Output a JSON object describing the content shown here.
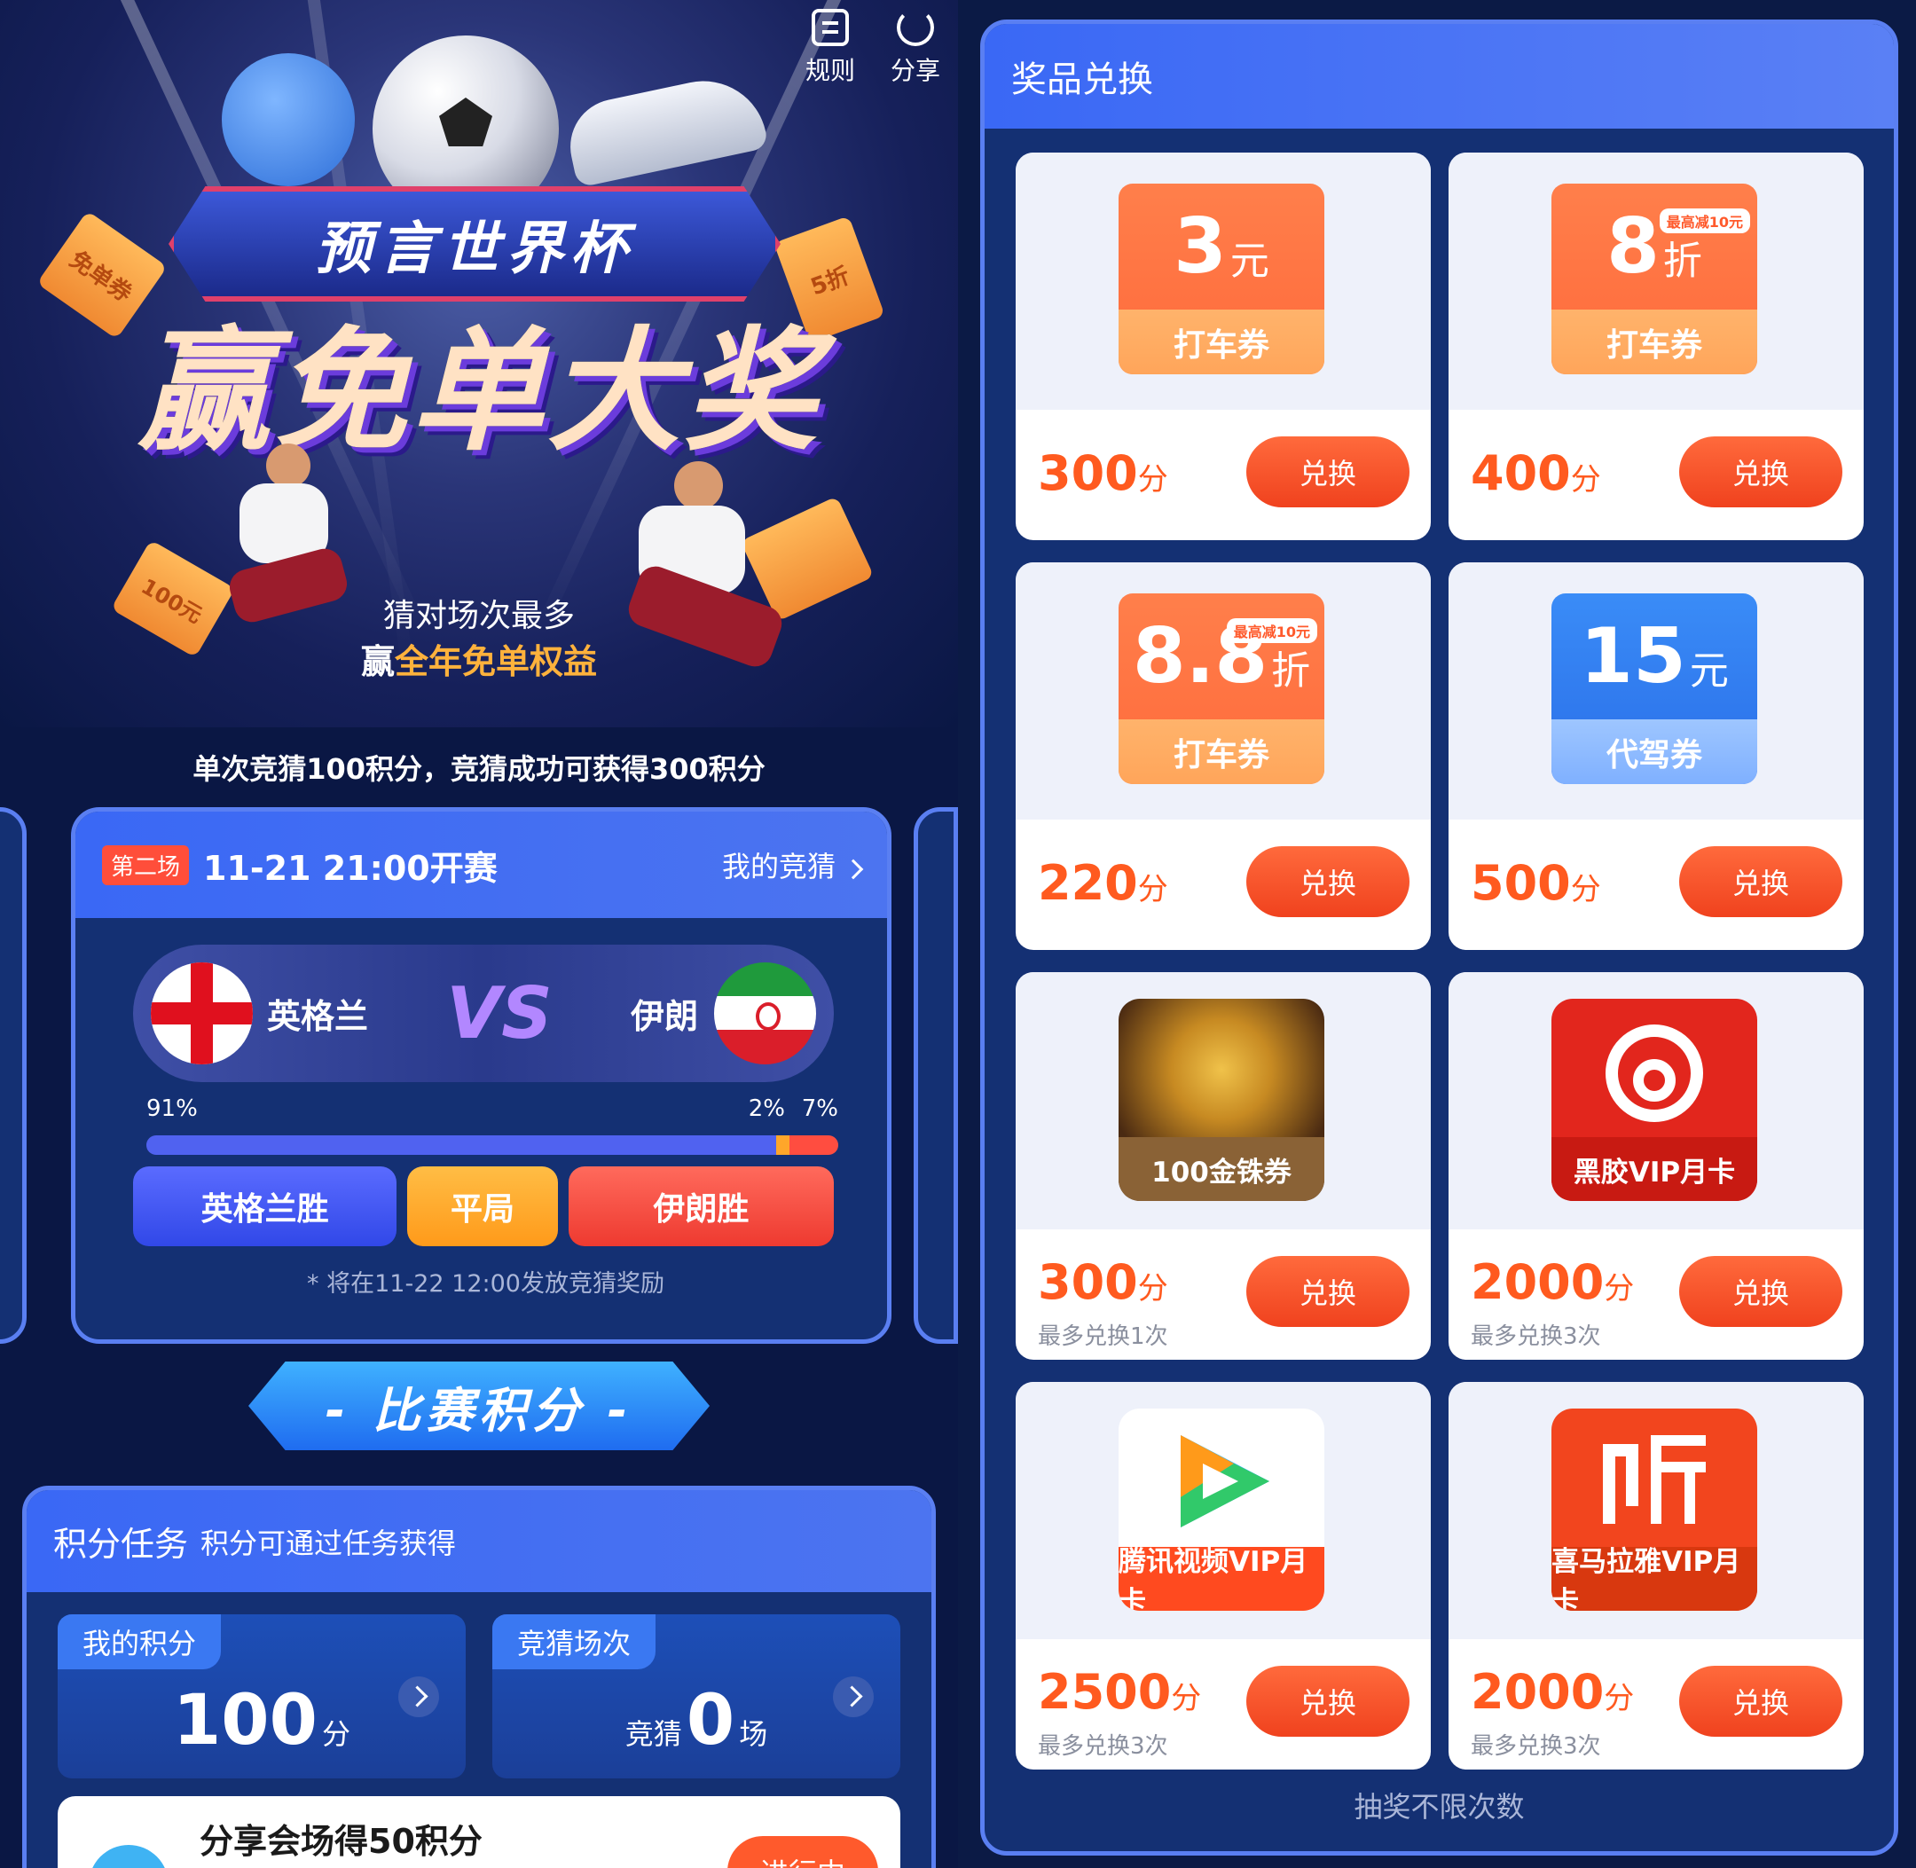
{
  "top_actions": {
    "rules": "规则",
    "share": "分享"
  },
  "hero": {
    "badge_title": "预言世界杯",
    "slogan": "赢免单大奖",
    "ticket_left": "免单券",
    "ticket_right": "5折",
    "ticket_bottom_left": "100元",
    "tagline": "猜对场次最多",
    "prize_prefix": "赢",
    "prize_highlight": "全年免单权益"
  },
  "rule_line": "单次竞猜100积分，竞猜成功可获得300积分",
  "match": {
    "round": "第二场",
    "kickoff": "11-21 21:00开赛",
    "my_guess": "我的竞猜",
    "team_a": "英格兰",
    "vs": "VS",
    "team_b": "伊朗",
    "pct_a": "91%",
    "pct_draw": "2%",
    "pct_b": "7%",
    "share_a": 91,
    "share_draw": 2,
    "share_b": 7,
    "vote_a": "英格兰胜",
    "vote_draw": "平局",
    "vote_b": "伊朗胜",
    "reward_note": "* 将在11-22 12:00发放竞猜奖励"
  },
  "score_banner": "- 比赛积分 -",
  "tasks": {
    "title": "积分任务",
    "subtitle": "积分可通过任务获得",
    "my_points_tab": "我的积分",
    "my_points_value": "100",
    "my_points_unit": "分",
    "guess_tab": "竞猜场次",
    "guess_prefix": "竞猜",
    "guess_value": "0",
    "guess_unit": "场",
    "share_task": "分享会场得50积分",
    "share_status": "进行中"
  },
  "prizes": {
    "title": "奖品兑换",
    "exchange_label": "兑换",
    "points_unit": "分",
    "items": [
      {
        "big": "3",
        "unit": "元",
        "kind": "打车券",
        "cap": "",
        "points": "300",
        "limit": ""
      },
      {
        "big": "8",
        "unit": "折",
        "kind": "打车券",
        "cap": "最高减10元",
        "points": "400",
        "limit": ""
      },
      {
        "big": "8.8",
        "unit": "折",
        "kind": "打车券",
        "cap": "最高减10元",
        "points": "220",
        "limit": ""
      },
      {
        "big": "15",
        "unit": "元",
        "kind": "代驾券",
        "cap": "",
        "points": "500",
        "limit": ""
      },
      {
        "label": "100金铢券",
        "points": "300",
        "limit": "最多兑换1次"
      },
      {
        "label": "黑胶VIP月卡",
        "points": "2000",
        "limit": "最多兑换3次"
      },
      {
        "label": "腾讯视频VIP月卡",
        "points": "2500",
        "limit": "最多兑换3次"
      },
      {
        "label": "喜马拉雅VIP月卡",
        "points": "2000",
        "limit": "最多兑换3次"
      }
    ],
    "footer": "抽奖不限次数"
  },
  "colors": {
    "accent_blue": "#3a68f5",
    "accent_orange": "#ff5a1f",
    "vote_a": "#3148e8",
    "vote_draw": "#ff9a1a",
    "vote_b": "#ee3a30"
  },
  "icons": [
    "rules-icon",
    "share-icon",
    "chevron-right-icon",
    "england-flag-icon",
    "iran-flag-icon",
    "netease-music-icon",
    "tencent-video-icon",
    "ximalaya-icon",
    "gold-coin-icon"
  ]
}
